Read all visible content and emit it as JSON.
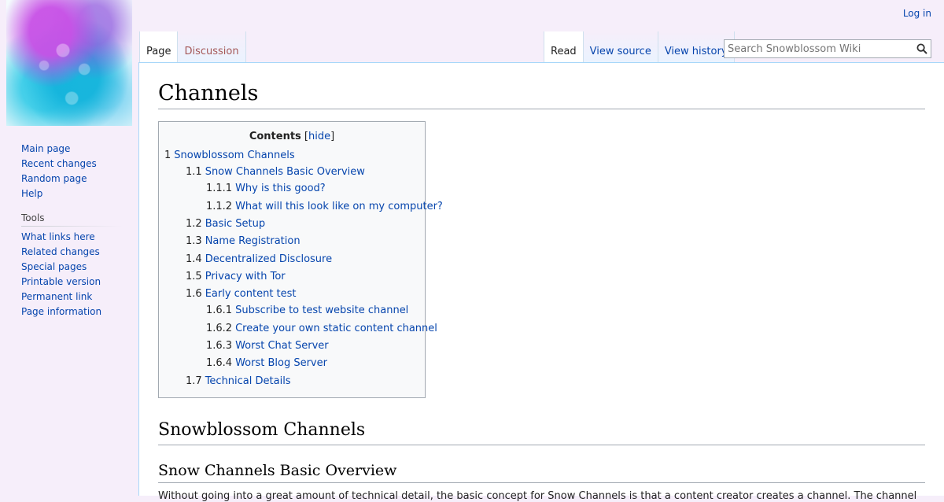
{
  "header": {
    "login_label": "Log in",
    "search_placeholder": "Search Snowblossom Wiki"
  },
  "tabs": {
    "left": [
      "Page",
      "Discussion"
    ],
    "right": [
      "Read",
      "View source",
      "View history"
    ]
  },
  "sidebar": {
    "navigation": [
      "Main page",
      "Recent changes",
      "Random page",
      "Help"
    ],
    "tools_heading": "Tools",
    "tools": [
      "What links here",
      "Related changes",
      "Special pages",
      "Printable version",
      "Permanent link",
      "Page information"
    ]
  },
  "page": {
    "title": "Channels",
    "toc": {
      "title": "Contents",
      "toggle_label": "hide",
      "items": [
        {
          "num": "1",
          "label": "Snowblossom Channels"
        },
        {
          "num": "1.1",
          "label": "Snow Channels Basic Overview"
        },
        {
          "num": "1.1.1",
          "label": "Why is this good?"
        },
        {
          "num": "1.1.2",
          "label": "What will this look like on my computer?"
        },
        {
          "num": "1.2",
          "label": "Basic Setup"
        },
        {
          "num": "1.3",
          "label": "Name Registration"
        },
        {
          "num": "1.4",
          "label": "Decentralized Disclosure"
        },
        {
          "num": "1.5",
          "label": "Privacy with Tor"
        },
        {
          "num": "1.6",
          "label": "Early content test"
        },
        {
          "num": "1.6.1",
          "label": "Subscribe to test website channel"
        },
        {
          "num": "1.6.2",
          "label": "Create your own static content channel"
        },
        {
          "num": "1.6.3",
          "label": "Worst Chat Server"
        },
        {
          "num": "1.6.4",
          "label": "Worst Blog Server"
        },
        {
          "num": "1.7",
          "label": "Technical Details"
        }
      ]
    },
    "heading_1": "Snowblossom Channels",
    "heading_2": "Snow Channels Basic Overview",
    "body_snippet": "Without going into a great amount of technical detail, the basic concept for Snow Channels is that a content creator creates a channel. The channel"
  },
  "colors": {
    "link": "#0645ad",
    "new_link": "#a55858",
    "page_background": "#f6eefa",
    "border": "#a7d7f9"
  }
}
